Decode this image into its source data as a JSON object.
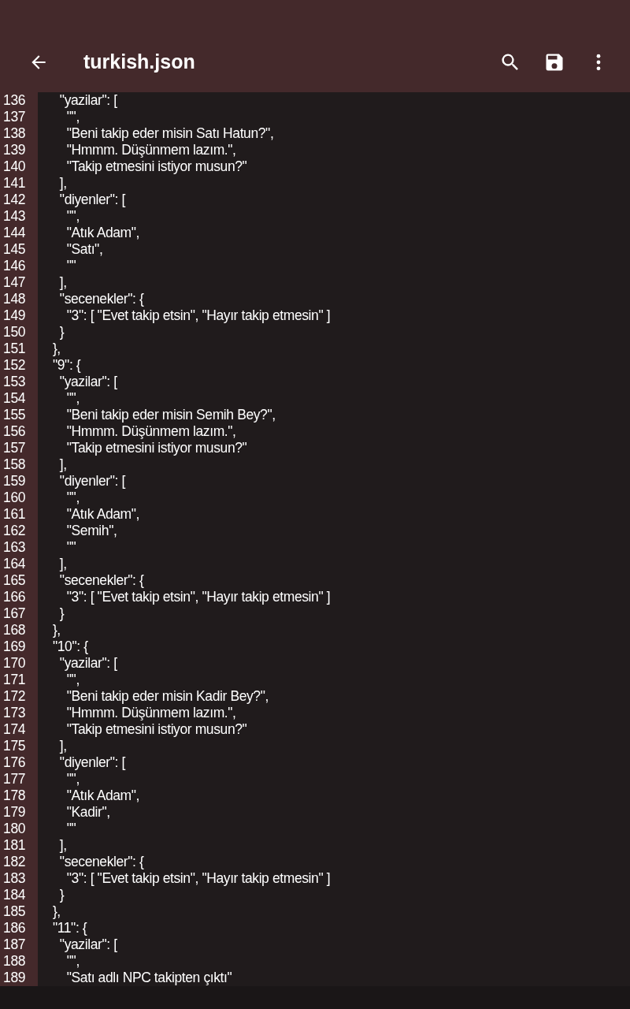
{
  "toolbar": {
    "title": "turkish.json"
  },
  "editor": {
    "lines": [
      {
        "number": "136",
        "text": "    \"yazilar\": ["
      },
      {
        "number": "137",
        "text": "      \"\","
      },
      {
        "number": "138",
        "text": "      \"Beni takip eder misin Satı Hatun?\","
      },
      {
        "number": "139",
        "text": "      \"Hmmm. Düşünmem lazım.\","
      },
      {
        "number": "140",
        "text": "      \"Takip etmesini istiyor musun?\""
      },
      {
        "number": "141",
        "text": "    ],"
      },
      {
        "number": "142",
        "text": "    \"diyenler\": ["
      },
      {
        "number": "143",
        "text": "      \"\","
      },
      {
        "number": "144",
        "text": "      \"Atık Adam\","
      },
      {
        "number": "145",
        "text": "      \"Satı\","
      },
      {
        "number": "146",
        "text": "      \"\""
      },
      {
        "number": "147",
        "text": "    ],"
      },
      {
        "number": "148",
        "text": "    \"secenekler\": {"
      },
      {
        "number": "149",
        "text": "      \"3\": [ \"Evet takip etsin\", \"Hayır takip etmesin\" ]"
      },
      {
        "number": "150",
        "text": "    }"
      },
      {
        "number": "151",
        "text": "  },"
      },
      {
        "number": "152",
        "text": "  \"9\": {"
      },
      {
        "number": "153",
        "text": "    \"yazilar\": ["
      },
      {
        "number": "154",
        "text": "      \"\","
      },
      {
        "number": "155",
        "text": "      \"Beni takip eder misin Semih Bey?\","
      },
      {
        "number": "156",
        "text": "      \"Hmmm. Düşünmem lazım.\","
      },
      {
        "number": "157",
        "text": "      \"Takip etmesini istiyor musun?\""
      },
      {
        "number": "158",
        "text": "    ],"
      },
      {
        "number": "159",
        "text": "    \"diyenler\": ["
      },
      {
        "number": "160",
        "text": "      \"\","
      },
      {
        "number": "161",
        "text": "      \"Atık Adam\","
      },
      {
        "number": "162",
        "text": "      \"Semih\","
      },
      {
        "number": "163",
        "text": "      \"\""
      },
      {
        "number": "164",
        "text": "    ],"
      },
      {
        "number": "165",
        "text": "    \"secenekler\": {"
      },
      {
        "number": "166",
        "text": "      \"3\": [ \"Evet takip etsin\", \"Hayır takip etmesin\" ]"
      },
      {
        "number": "167",
        "text": "    }"
      },
      {
        "number": "168",
        "text": "  },"
      },
      {
        "number": "169",
        "text": "  \"10\": {"
      },
      {
        "number": "170",
        "text": "    \"yazilar\": ["
      },
      {
        "number": "171",
        "text": "      \"\","
      },
      {
        "number": "172",
        "text": "      \"Beni takip eder misin Kadir Bey?\","
      },
      {
        "number": "173",
        "text": "      \"Hmmm. Düşünmem lazım.\","
      },
      {
        "number": "174",
        "text": "      \"Takip etmesini istiyor musun?\""
      },
      {
        "number": "175",
        "text": "    ],"
      },
      {
        "number": "176",
        "text": "    \"diyenler\": ["
      },
      {
        "number": "177",
        "text": "      \"\","
      },
      {
        "number": "178",
        "text": "      \"Atık Adam\","
      },
      {
        "number": "179",
        "text": "      \"Kadir\","
      },
      {
        "number": "180",
        "text": "      \"\""
      },
      {
        "number": "181",
        "text": "    ],"
      },
      {
        "number": "182",
        "text": "    \"secenekler\": {"
      },
      {
        "number": "183",
        "text": "      \"3\": [ \"Evet takip etsin\", \"Hayır takip etmesin\" ]"
      },
      {
        "number": "184",
        "text": "    }"
      },
      {
        "number": "185",
        "text": "  },"
      },
      {
        "number": "186",
        "text": "  \"11\": {"
      },
      {
        "number": "187",
        "text": "    \"yazilar\": ["
      },
      {
        "number": "188",
        "text": "      \"\","
      },
      {
        "number": "189",
        "text": "      \"Satı adlı NPC takipten çıktı\""
      }
    ]
  }
}
